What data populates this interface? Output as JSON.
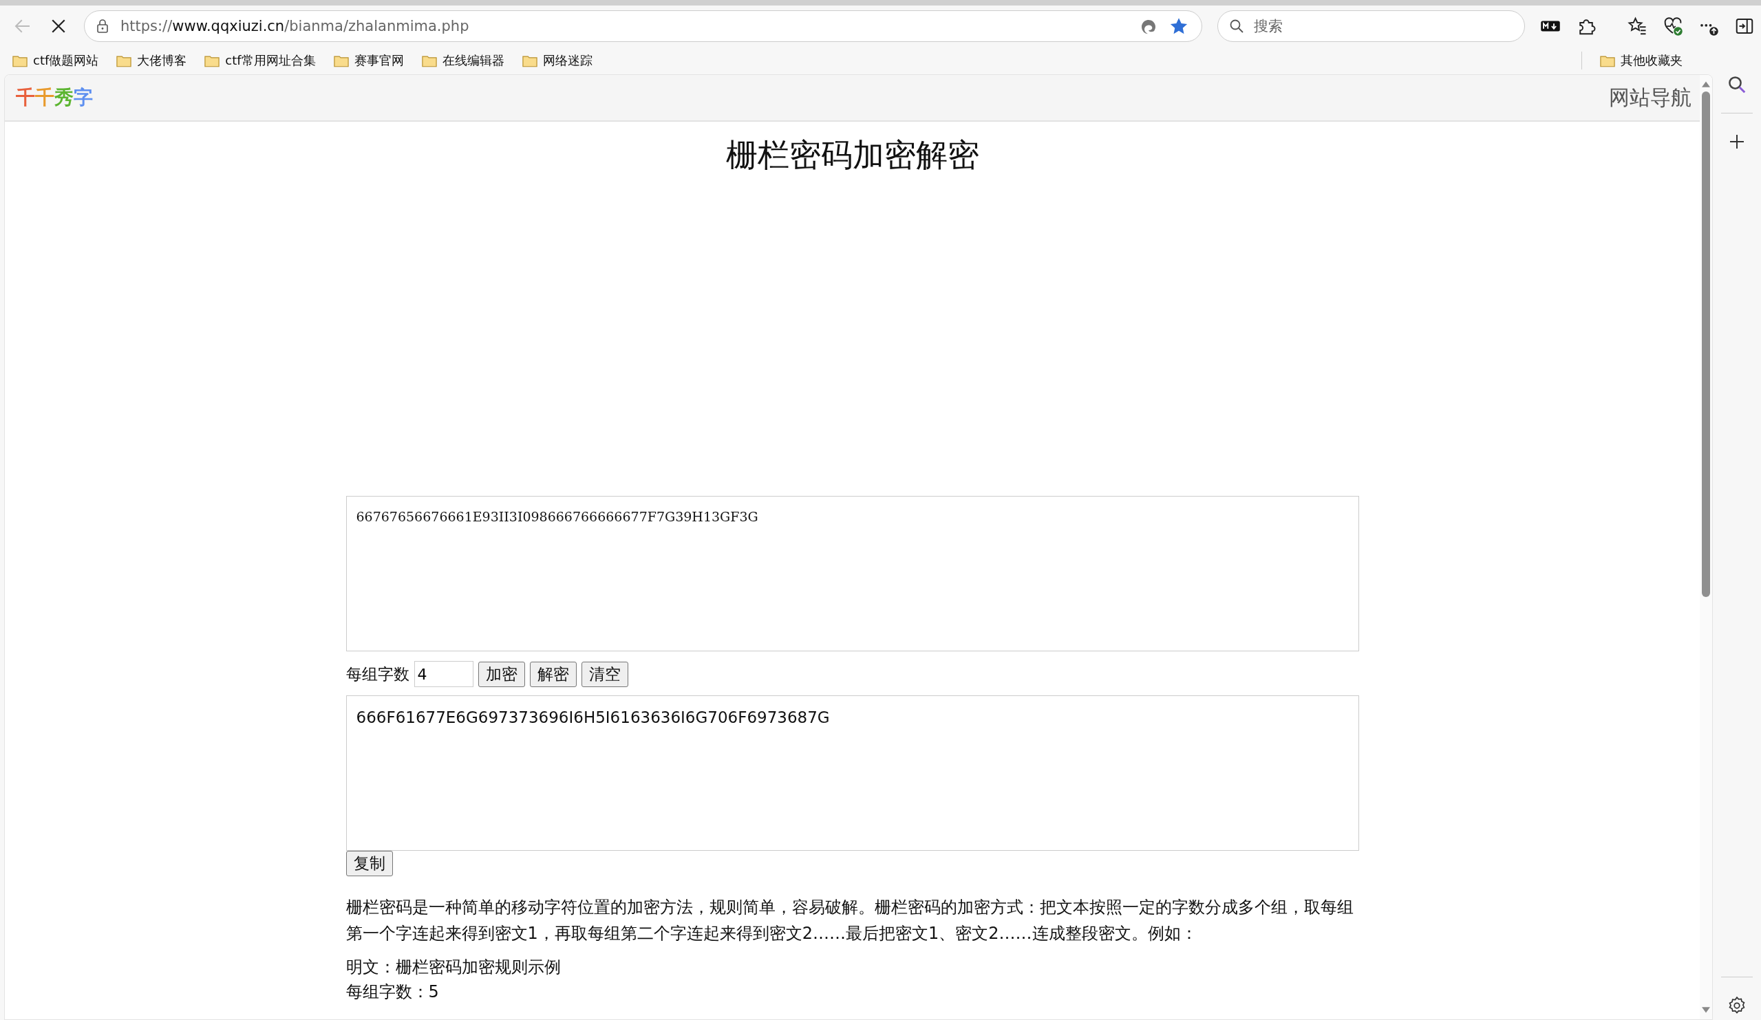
{
  "browser": {
    "url_scheme": "https://",
    "url_host": "www.qqxiuzi.cn",
    "url_path": "/bianma/zhalanmima.php",
    "search_placeholder": "搜索"
  },
  "bookmarks": [
    "ctf做题网站",
    "大佬博客",
    "ctf常用网址合集",
    "赛事官网",
    "在线编辑器",
    "网络迷踪"
  ],
  "other_bookmarks": "其他收藏夹",
  "site": {
    "logo": [
      {
        "char": "千",
        "color": "#e8603c"
      },
      {
        "char": "千",
        "color": "#e89a2c"
      },
      {
        "char": "秀",
        "color": "#5cb531"
      },
      {
        "char": "字",
        "color": "#5d8ff0"
      }
    ],
    "nav": "网站导航"
  },
  "page": {
    "title": "栅栏密码加密解密",
    "input_text": "66767656676661E93II3I098666766666677F7G39H13GF3G",
    "group_size_label": "每组字数",
    "group_size": "4",
    "buttons": [
      "加密",
      "解密",
      "清空"
    ],
    "output_text": "666F61677E6G697373696I6H5I6163636I6G706F6973687G",
    "copy_button": "复制",
    "description": "栅栏密码是一种简单的移动字符位置的加密方法，规则简单，容易破解。栅栏密码的加密方式：把文本按照一定的字数分成多个组，取每组第一个字连起来得到密文1，再取每组第二个字连起来得到密文2……最后把密文1、密文2……连成整段密文。例如：",
    "example_lines": [
      "明文：栅栏密码加密规则示例",
      "每组字数：5"
    ]
  }
}
